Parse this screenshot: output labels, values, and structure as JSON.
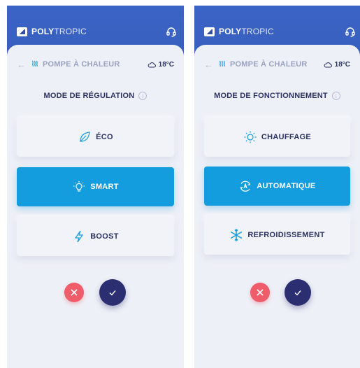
{
  "brand": {
    "bold": "POLY",
    "light": "TROPIC"
  },
  "screens": [
    {
      "subheader": {
        "title": "POMPE À CHALEUR",
        "temperature": "18°C"
      },
      "mode_title": "MODE DE RÉGULATION",
      "info": "i",
      "options": [
        {
          "label": "ÉCO",
          "icon": "leaf-icon",
          "selected": false
        },
        {
          "label": "SMART",
          "icon": "lightbulb-icon",
          "selected": true
        },
        {
          "label": "BOOST",
          "icon": "lightning-icon",
          "selected": false
        }
      ]
    },
    {
      "subheader": {
        "title": "POMPE À CHALEUR",
        "temperature": "18°C"
      },
      "mode_title": "MODE DE FONCTIONNEMENT",
      "info": "i",
      "options": [
        {
          "label": "CHAUFFAGE",
          "icon": "sun-icon",
          "selected": false
        },
        {
          "label": "AUTOMATIQUE",
          "icon": "auto-icon",
          "selected": true
        },
        {
          "label": "REFROIDISSEMENT",
          "icon": "snowflake-icon",
          "selected": false
        }
      ]
    }
  ],
  "colors": {
    "header_blue": "#2f4fa8",
    "selected_blue": "#139ddf",
    "navy": "#2b2f72",
    "cancel_red": "#ef5c6a",
    "background": "#eef0f7"
  }
}
